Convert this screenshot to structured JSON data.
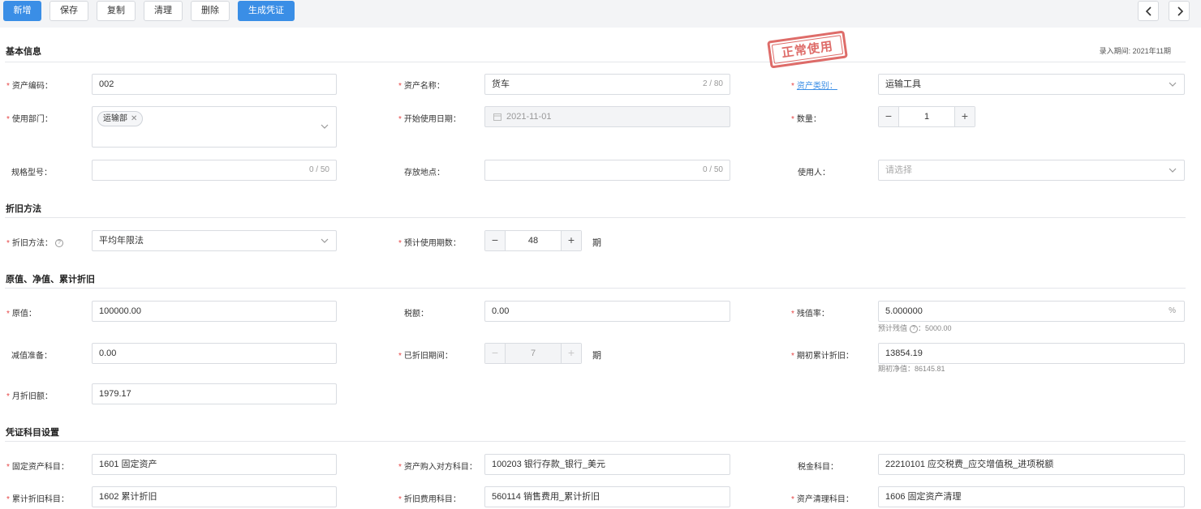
{
  "toolbar": {
    "new": "新增",
    "save": "保存",
    "copy": "复制",
    "clear": "清理",
    "delete": "删除",
    "generate_voucher": "生成凭证"
  },
  "stamp": "正常使用",
  "entry_period": "录入期间: 2021年11期",
  "sections": {
    "basic": "基本信息",
    "depreciation_method": "折旧方法",
    "values": "原值、净值、累计折旧",
    "voucher": "凭证科目设置"
  },
  "basic": {
    "asset_code_label": "资产编码：",
    "asset_code": "002",
    "asset_name_label": "资产名称：",
    "asset_name": "货车",
    "asset_name_counter": "2 / 80",
    "asset_category_label": "资产类别：",
    "asset_category": "运输工具",
    "department_label": "使用部门：",
    "department_tag": "运输部",
    "start_date_label": "开始使用日期：",
    "start_date": "2021-11-01",
    "quantity_label": "数量：",
    "quantity": "1",
    "spec_label": "规格型号：",
    "spec_counter": "0 / 50",
    "location_label": "存放地点：",
    "location_counter": "0 / 50",
    "user_label": "使用人：",
    "user_placeholder": "请选择"
  },
  "depreciation": {
    "method_label": "折旧方法：",
    "method": "平均年限法",
    "periods_label": "预计使用期数：",
    "periods": "48",
    "period_unit": "期"
  },
  "values": {
    "original_label": "原值：",
    "original": "100000.00",
    "tax_label": "税额：",
    "tax": "0.00",
    "residual_rate_label": "残值率：",
    "residual_rate": "5.000000",
    "residual_rate_unit": "%",
    "residual_hint_prefix": "预计残值",
    "residual_hint_value": "：5000.00",
    "impairment_label": "减值准备：",
    "impairment": "0.00",
    "depreciated_periods_label": "已折旧期间：",
    "depreciated_periods": "7",
    "period_unit": "期",
    "opening_accum_label": "期初累计折旧：",
    "opening_accum": "13854.19",
    "opening_net_hint": "期初净值：86145.81",
    "monthly_label": "月折旧额：",
    "monthly": "1979.17"
  },
  "voucher": {
    "fixed_asset_label": "固定资产科目：",
    "fixed_asset": "1601 固定资产",
    "purchase_label": "资产购入对方科目：",
    "purchase": "100203 银行存款_银行_美元",
    "tax_account_label": "税金科目：",
    "tax_account": "22210101 应交税费_应交增值税_进项税额",
    "accum_label": "累计折旧科目：",
    "accum": "1602 累计折旧",
    "expense_label": "折旧费用科目：",
    "expense": "560114 销售费用_累计折旧",
    "disposal_label": "资产清理科目：",
    "disposal": "1606 固定资产清理"
  }
}
